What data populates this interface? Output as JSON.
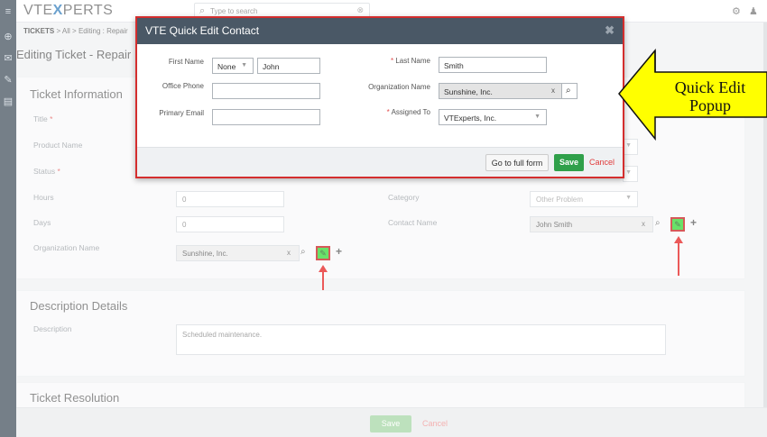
{
  "app": {
    "logo_text": "VTE",
    "logo_x": "X",
    "logo_rest": "PERTS",
    "search_placeholder": "Type to search"
  },
  "breadcrumb": {
    "root": "TICKETS",
    "sep1": ">",
    "all": "All",
    "sep2": ">",
    "current": "Editing : Repair"
  },
  "page_title": "Editing Ticket - Repair",
  "ticket_info": {
    "title": "Ticket Information",
    "labels": {
      "title": "Title",
      "product_name": "Product Name",
      "status": "Status",
      "hours": "Hours",
      "days": "Days",
      "organization_name": "Organization Name",
      "category": "Category",
      "contact_name": "Contact Name"
    },
    "required_mark": "*",
    "values": {
      "hours": "0",
      "days": "0",
      "organization_name": "Sunshine, Inc.",
      "category": "Other Problem",
      "contact_name": "John Smith"
    },
    "clear": "x",
    "plus": "+"
  },
  "description": {
    "title": "Description Details",
    "label": "Description",
    "value": "Scheduled maintenance."
  },
  "resolution": {
    "title": "Ticket Resolution"
  },
  "bottom": {
    "save": "Save",
    "cancel": "Cancel"
  },
  "modal": {
    "title": "VTE Quick Edit Contact",
    "first_name_label": "First Name",
    "salutation": "None",
    "first_name": "John",
    "last_name_label": "Last Name",
    "last_name": "Smith",
    "office_phone_label": "Office Phone",
    "office_phone": "",
    "org_label": "Organization Name",
    "org_value": "Sunshine, Inc.",
    "org_clear": "x",
    "primary_email_label": "Primary Email",
    "primary_email": "",
    "assigned_label": "Assigned To",
    "assigned_value": "VTExperts, Inc.",
    "required_mark": "*",
    "go_full": "Go to full form",
    "save": "Save",
    "cancel": "Cancel"
  },
  "callout": {
    "line1": "Quick Edit",
    "line2": "Popup"
  },
  "colors": {
    "modal_header": "#4a5866",
    "modal_border": "#d42e2e",
    "save_green": "#2fa04a",
    "quick_edit_button": "#19d119",
    "callout_fill": "#ffff00",
    "arrow_red": "#e00000"
  }
}
